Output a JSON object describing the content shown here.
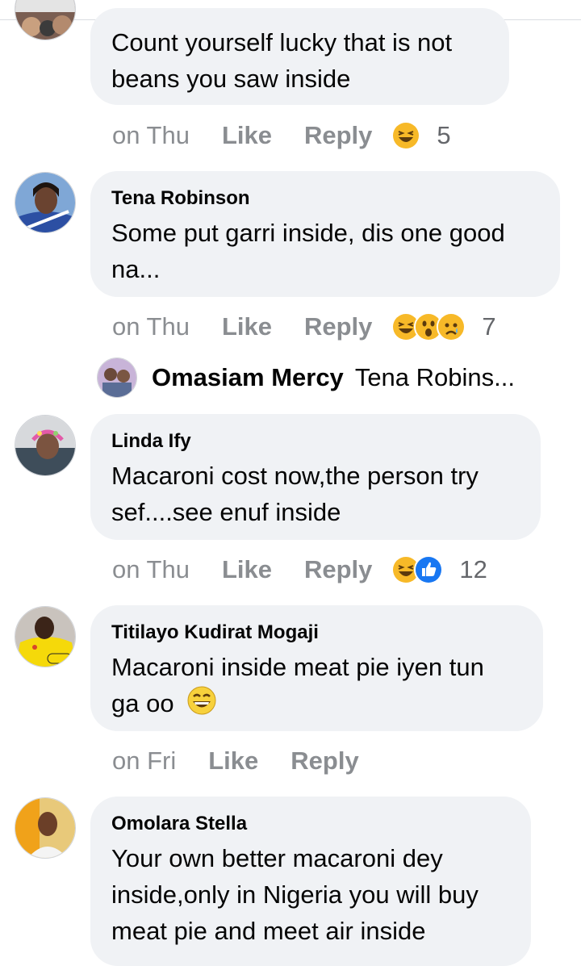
{
  "comments": [
    {
      "author": "",
      "text_lines": [
        "Count yourself lucky that is not",
        "beans you saw inside"
      ],
      "time": "on Thu",
      "like": "Like",
      "reply": "Reply",
      "reaction_count": "5",
      "reactions": [
        "laugh-icon"
      ]
    },
    {
      "author": "Tena Robinson",
      "text_lines": [
        "Some put garri inside, dis one good",
        "na..."
      ],
      "time": "on Thu",
      "like": "Like",
      "reply": "Reply",
      "reaction_count": "7",
      "reactions": [
        "laugh-icon",
        "wow-icon",
        "sad-icon"
      ]
    },
    {
      "author": "Linda Ify",
      "text_lines": [
        "Macaroni cost now,the person try",
        "sef....see enuf inside"
      ],
      "time": "on Thu",
      "like": "Like",
      "reply": "Reply",
      "reaction_count": "12",
      "reactions": [
        "laugh-icon",
        "like-icon"
      ]
    },
    {
      "author": "Titilayo Kudirat Mogaji",
      "text_lines": [
        "Macaroni inside meat pie iyen tun",
        "ga oo"
      ],
      "time": "on Fri",
      "like": "Like",
      "reply": "Reply"
    },
    {
      "author": "Omolara Stella",
      "text_lines": [
        "Your own better macaroni dey",
        "inside,only in Nigeria you will buy",
        "meat pie and meet air inside"
      ]
    }
  ],
  "reply_preview": {
    "author": "Omasiam Mercy",
    "text": "Tena Robins..."
  },
  "colors": {
    "bubble_bg": "#f0f2f5",
    "meta_text": "#8a8d91",
    "like_blue": "#1877f2",
    "emoji_yellow": "#f7b928"
  }
}
